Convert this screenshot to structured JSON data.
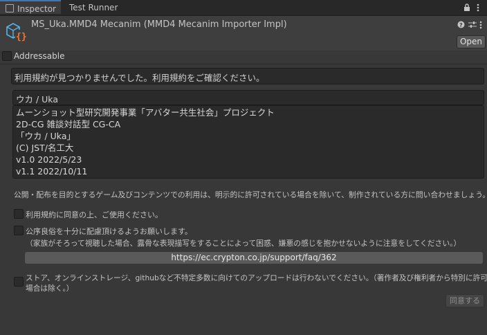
{
  "tabs": [
    {
      "label": "Inspector",
      "active": true
    },
    {
      "label": "Test Runner",
      "active": false
    }
  ],
  "icons": {
    "lock": "lock-icon",
    "menu": "kebab-menu-icon",
    "help": "help-icon",
    "settings": "sliders-icon",
    "asset": "script-asset-icon"
  },
  "header": {
    "title": "MS_Uka.MMD4 Mecanim (MMD4 Mecanim Importer Impl)",
    "open_label": "Open"
  },
  "addressable": {
    "label": "Addressable",
    "checked": false
  },
  "license": {
    "warning": "利用規約が見つかりませんでした。利用規約をご確認ください。",
    "name": "ウカ / Uka",
    "info_lines": [
      "ムーンショット型研究開発事業「アバター共生社会」プロジェクト",
      "2D-CG 雑談対話型 CG-CA",
      "「ウカ / Uka」",
      "(C) JST/名工大",
      "v1.0  2022/5/23",
      "v1.1  2022/10/11"
    ],
    "notice": "公開・配布を目的とするゲーム及びコンテンツでの利用は、明示的に許可されている場合を除いて、制作されている方に問い合わせましょう。",
    "check1": "利用規約に同意の上、ご使用ください。",
    "check2": "公序良俗を十分に配慮頂けるようお願いします。",
    "check2_sub": "（家族がそろって視聴した場合、露骨な表現描写をすることによって困惑、嫌悪の感じを抱かせないように注意をしてください。）",
    "url": "https://ec.crypton.co.jp/support/faq/362",
    "check3_line1": "ストア、オンラインストレージ、githubなど不特定多数に向けてのアップロードは行わないでください。（著作者及び権利者から特別に許可を得た",
    "check3_line2": "場合は除く。）",
    "agree_label": "同意する"
  }
}
